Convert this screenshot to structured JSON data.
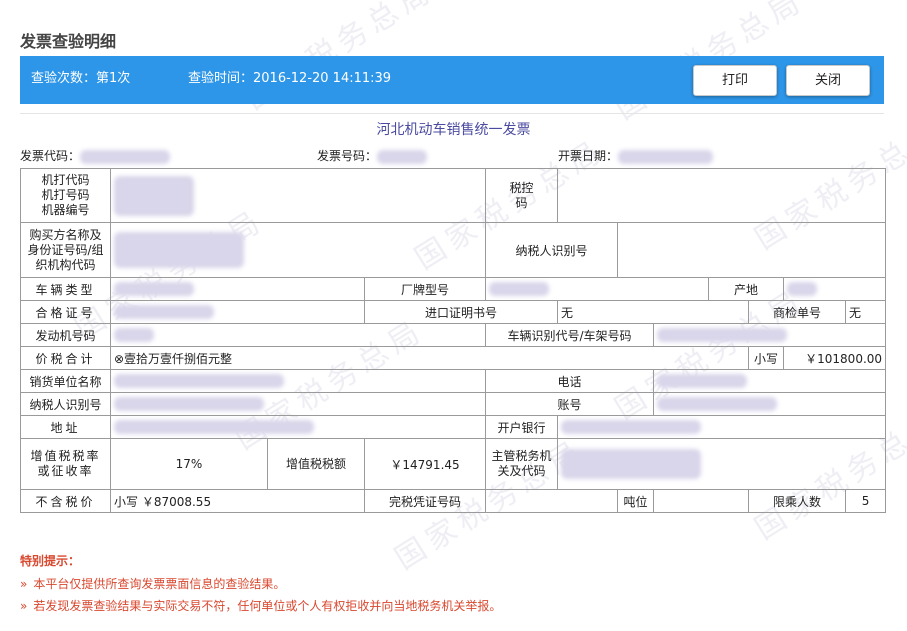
{
  "page_title": "发票查验明细",
  "info_bar": {
    "count_text": "查验次数：第1次",
    "time_text": "查验时间：2016-12-20 14:11:39",
    "print_label": "打印",
    "close_label": "关闭",
    "bg_color": "#2e96e8"
  },
  "watermark_text": "国家税务总局",
  "invoice": {
    "title": "河北机动车销售统一发票",
    "code_label": "发票代码：",
    "number_label": "发票号码：",
    "date_label": "开票日期：",
    "rows": {
      "machine_code_label": "机打代码",
      "machine_number_label": "机打号码",
      "machine_serial_label": "机器编号",
      "tax_control_label": "税控码",
      "buyer_label": "购买方名称及身份证号码/组织机构代码",
      "taxpayer_id_label": "纳税人识别号",
      "vehicle_type_label": "车辆类型",
      "brand_model_label": "厂牌型号",
      "origin_label": "产地",
      "certificate_label": "合格证号",
      "import_cert_label": "进口证明书号",
      "import_cert_value": "无",
      "inspection_label": "商检单号",
      "inspection_value": "无",
      "engine_label": "发动机号码",
      "vin_label": "车辆识别代号/车架号码",
      "total_label": "价税合计",
      "total_upper": "⊗壹拾万壹仟捌佰元整",
      "small_label": "小写",
      "total_small": "￥101800.00",
      "seller_label": "销货单位名称",
      "phone_label": "电话",
      "seller_taxpayer_label": "纳税人识别号",
      "account_label": "账号",
      "address_label": "地址",
      "bank_label": "开户银行",
      "tax_rate_label": "增值税税率或征收率",
      "tax_rate_value": "17%",
      "tax_amount_label": "增值税税额",
      "tax_amount_value": "￥14791.45",
      "authority_label": "主管税务机关及代码",
      "pretax_label": "不含税价",
      "pretax_value": "小写 ￥87008.55",
      "duty_paid_label": "完税凭证号码",
      "tonnage_label": "吨位",
      "passenger_label": "限乘人数",
      "passenger_value": "5"
    }
  },
  "notice": {
    "title": "特别提示：",
    "item1": "本平台仅提供所查询发票票面信息的查验结果。",
    "item2": "若发现发票查验结果与实际交易不符，任何单位或个人有权拒收并向当地税务机关举报。",
    "marker": "»",
    "color": "#d9482f"
  }
}
